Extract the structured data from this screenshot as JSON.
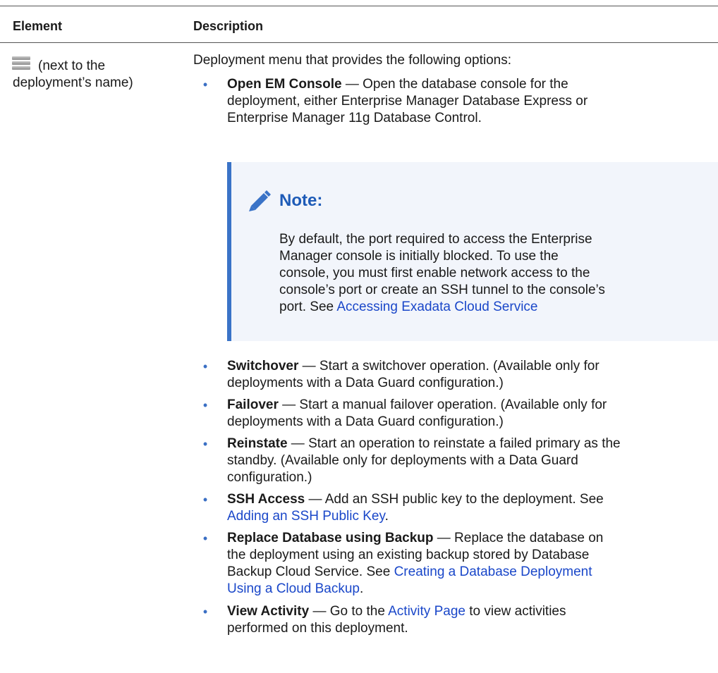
{
  "table": {
    "headers": [
      "Element",
      "Description"
    ]
  },
  "element": {
    "icon": "menu-icon",
    "line1": "(next to the",
    "line2": "deployment’s name)"
  },
  "description": {
    "intro": "Deployment menu that provides the following options:",
    "open_em": {
      "label": "Open EM Console",
      "line1": " — Open the database console for the",
      "line2": "deployment, either Enterprise Manager Database Express or",
      "line3": "Enterprise Manager 11g Database Control."
    },
    "note": {
      "title": "Note:",
      "icon": "pencil-icon",
      "line1": "By default, the port required to access the Enterprise",
      "line2": "Manager console is initially blocked. To use the",
      "line3": "console, you must first enable network access to the",
      "line4": "console’s port or create an SSH tunnel to the console’s",
      "line5_prefix": "port. See ",
      "link": "Accessing Exadata Cloud Service"
    },
    "switchover": {
      "label": "Switchover",
      "line1": " — Start a switchover operation. (Available only for",
      "line2": "deployments with a Data Guard configuration.)"
    },
    "failover": {
      "label": "Failover",
      "line1": " — Start a manual failover operation. (Available only for",
      "line2": "deployments with a Data Guard configuration.)"
    },
    "reinstate": {
      "label": "Reinstate",
      "line1": " — Start an operation to reinstate a failed primary as the",
      "line2": "standby. (Available only for deployments with a Data Guard",
      "line3": "configuration.)"
    },
    "ssh": {
      "label": "SSH Access",
      "line1": " — Add an SSH public key to the deployment. See",
      "link": "Adding an SSH Public Key",
      "suffix": "."
    },
    "replace": {
      "label": "Replace Database using Backup",
      "line1": " — Replace the database on",
      "line2": "the deployment using an existing backup stored by Database",
      "line3_prefix": "Backup Cloud Service. See ",
      "link1": "Creating a Database Deployment",
      "link2": "Using a Cloud Backup",
      "suffix": "."
    },
    "activity": {
      "label": "View Activity",
      "line1_prefix": " — Go to the ",
      "link": "Activity Page",
      "line1_suffix": " to view activities",
      "line2": "performed on this deployment."
    },
    "bullet_char": "•"
  },
  "colors": {
    "note_accent": "#3a73c7",
    "note_bg": "#f2f5fb",
    "link": "#1a47c9",
    "bullet": "#3a6fc4"
  }
}
